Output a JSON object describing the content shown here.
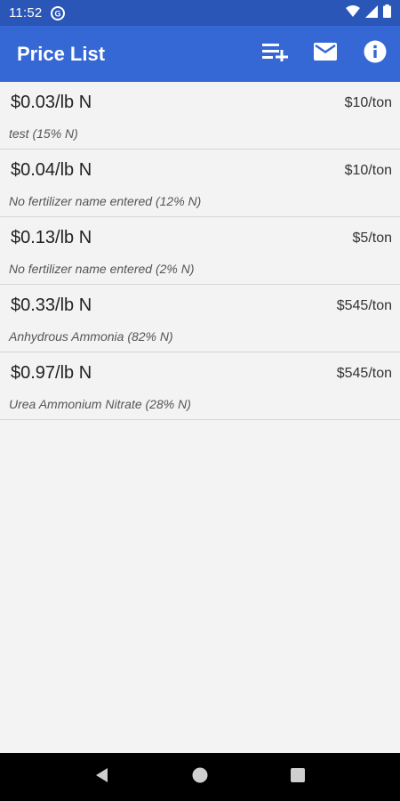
{
  "status_bar": {
    "time": "11:52",
    "icons": [
      "app-notification-icon",
      "wifi-icon",
      "cell-signal-icon",
      "battery-icon"
    ]
  },
  "app_bar": {
    "title": "Price List",
    "actions": [
      "playlist-add-icon",
      "email-icon",
      "info-icon"
    ]
  },
  "items": [
    {
      "price": "$0.03/lb N",
      "cost": "$10/ton",
      "name": "test (15% N)"
    },
    {
      "price": "$0.04/lb N",
      "cost": "$10/ton",
      "name": "No fertilizer name entered (12% N)"
    },
    {
      "price": "$0.13/lb N",
      "cost": "$5/ton",
      "name": "No fertilizer name entered (2% N)"
    },
    {
      "price": "$0.33/lb N",
      "cost": "$545/ton",
      "name": "Anhydrous Ammonia (82% N)"
    },
    {
      "price": "$0.97/lb N",
      "cost": "$545/ton",
      "name": "Urea Ammonium Nitrate (28% N)"
    }
  ],
  "nav_bar": {
    "buttons": [
      "back-icon",
      "home-icon",
      "recents-icon"
    ]
  },
  "colors": {
    "status_bar": "#2a56b8",
    "app_bar": "#3568d4",
    "background": "#f3f3f3",
    "nav_bar": "#000000"
  }
}
